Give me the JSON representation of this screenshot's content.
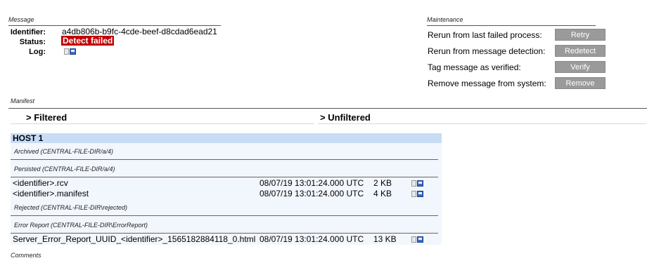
{
  "message": {
    "section_title": "Message",
    "identifier_label": "Identifier:",
    "identifier_value": "a4db806b-b9fc-4cde-beef-d8cdad6ead21",
    "status_label": "Status:",
    "status_value": "Detect failed",
    "log_label": "Log:",
    "status_color": "#c20000"
  },
  "maintenance": {
    "section_title": "Maintenance",
    "rows": [
      {
        "label": "Rerun from last failed process:",
        "button": "Retry"
      },
      {
        "label": "Rerun from message detection:",
        "button": "Redetect"
      },
      {
        "label": "Tag message as verified:",
        "button": "Verify"
      },
      {
        "label": "Remove message from system:",
        "button": "Remove"
      }
    ],
    "button_color": "#9a9a9a"
  },
  "manifest": {
    "section_title": "Manifest",
    "tab_filtered": "> Filtered",
    "tab_unfiltered": "> Unfiltered",
    "host_title": "HOST 1",
    "host_color": "#c9dcf5",
    "groups": [
      {
        "title": "Archived (CENTRAL-FILE-DIR/a/4)",
        "files": []
      },
      {
        "title": "Persisted (CENTRAL-FILE-DIR/a/4)",
        "files": [
          {
            "name": "<identifier>.rcv",
            "date": "08/07/19 13:01:24.000 UTC",
            "size": "2 KB"
          },
          {
            "name": "<identifier>.manifest",
            "date": "08/07/19 13:01:24.000 UTC",
            "size": "4 KB"
          }
        ]
      },
      {
        "title": "Rejected (CENTRAL-FILE-DIR\\rejected)",
        "files": []
      },
      {
        "title": "Error Report (CENTRAL-FILE-DIR\\ErrorReport)",
        "files": [
          {
            "name": "Server_Error_Report_UUID_<identifier>_1565182884118_0.html",
            "date": "08/07/19 13:01:24.000 UTC",
            "size": "13 KB"
          }
        ]
      }
    ]
  },
  "comments": {
    "section_title": "Comments"
  }
}
